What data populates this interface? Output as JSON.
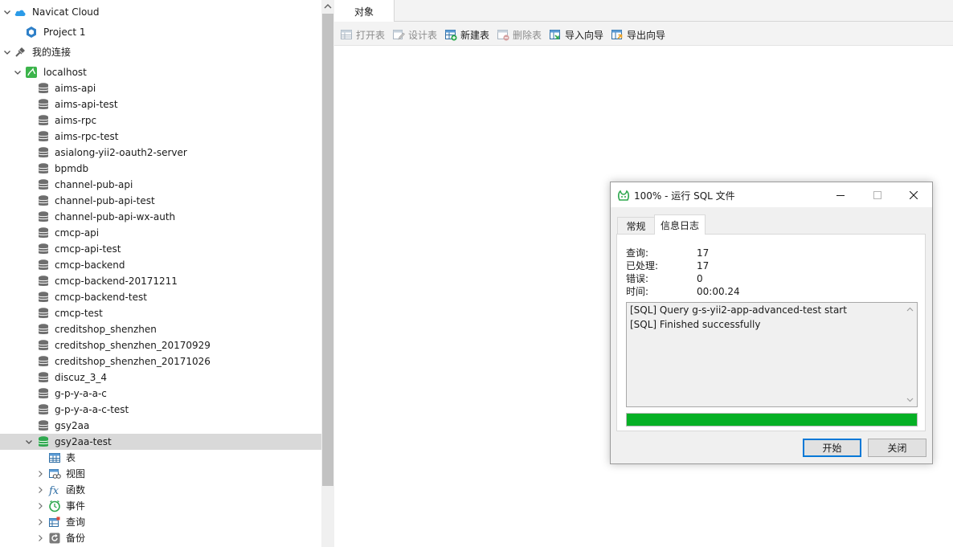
{
  "nav": {
    "cloud_label": "Navicat Cloud",
    "project_label": "Project 1",
    "my_connections_label": "我的连接",
    "server_label": "localhost",
    "databases": [
      "aims-api",
      "aims-api-test",
      "aims-rpc",
      "aims-rpc-test",
      "asialong-yii2-oauth2-server",
      "bpmdb",
      "channel-pub-api",
      "channel-pub-api-test",
      "channel-pub-api-wx-auth",
      "cmcp-api",
      "cmcp-api-test",
      "cmcp-backend",
      "cmcp-backend-20171211",
      "cmcp-backend-test",
      "cmcp-test",
      "creditshop_shenzhen",
      "creditshop_shenzhen_20170929",
      "creditshop_shenzhen_20171026",
      "discuz_3_4",
      "g-p-y-a-a-c",
      "g-p-y-a-a-c-test",
      "gsy2aa"
    ],
    "selected_db_label": "gsy2aa-test",
    "children": [
      "表",
      "视图",
      "函数",
      "事件",
      "查询",
      "备份"
    ]
  },
  "main": {
    "tab_label": "对象",
    "toolbar": {
      "open_table": "打开表",
      "design_table": "设计表",
      "new_table": "新建表",
      "delete_table": "删除表",
      "import_wizard": "导入向导",
      "export_wizard": "导出向导"
    }
  },
  "dialog": {
    "title": "100% - 运行 SQL 文件",
    "tabs": {
      "general": "常规",
      "log": "信息日志"
    },
    "stats": [
      {
        "label": "查询:",
        "value": "17"
      },
      {
        "label": "已处理:",
        "value": "17"
      },
      {
        "label": "错误:",
        "value": "0"
      },
      {
        "label": "时间:",
        "value": "00:00.24"
      }
    ],
    "log_lines": [
      "[SQL] Query g-s-yii2-app-advanced-test start",
      "[SQL] Finished successfully"
    ],
    "progress_percent": 100,
    "start_button": "开始",
    "close_button": "关闭"
  },
  "colors": {
    "progress_green": "#06b025",
    "selected_row": "#d9d9d9",
    "db_icon_gray": "#6e6e6e",
    "db_icon_green": "#2fa84f",
    "cloud_blue": "#2b9be8",
    "server_green": "#3cb44b"
  }
}
